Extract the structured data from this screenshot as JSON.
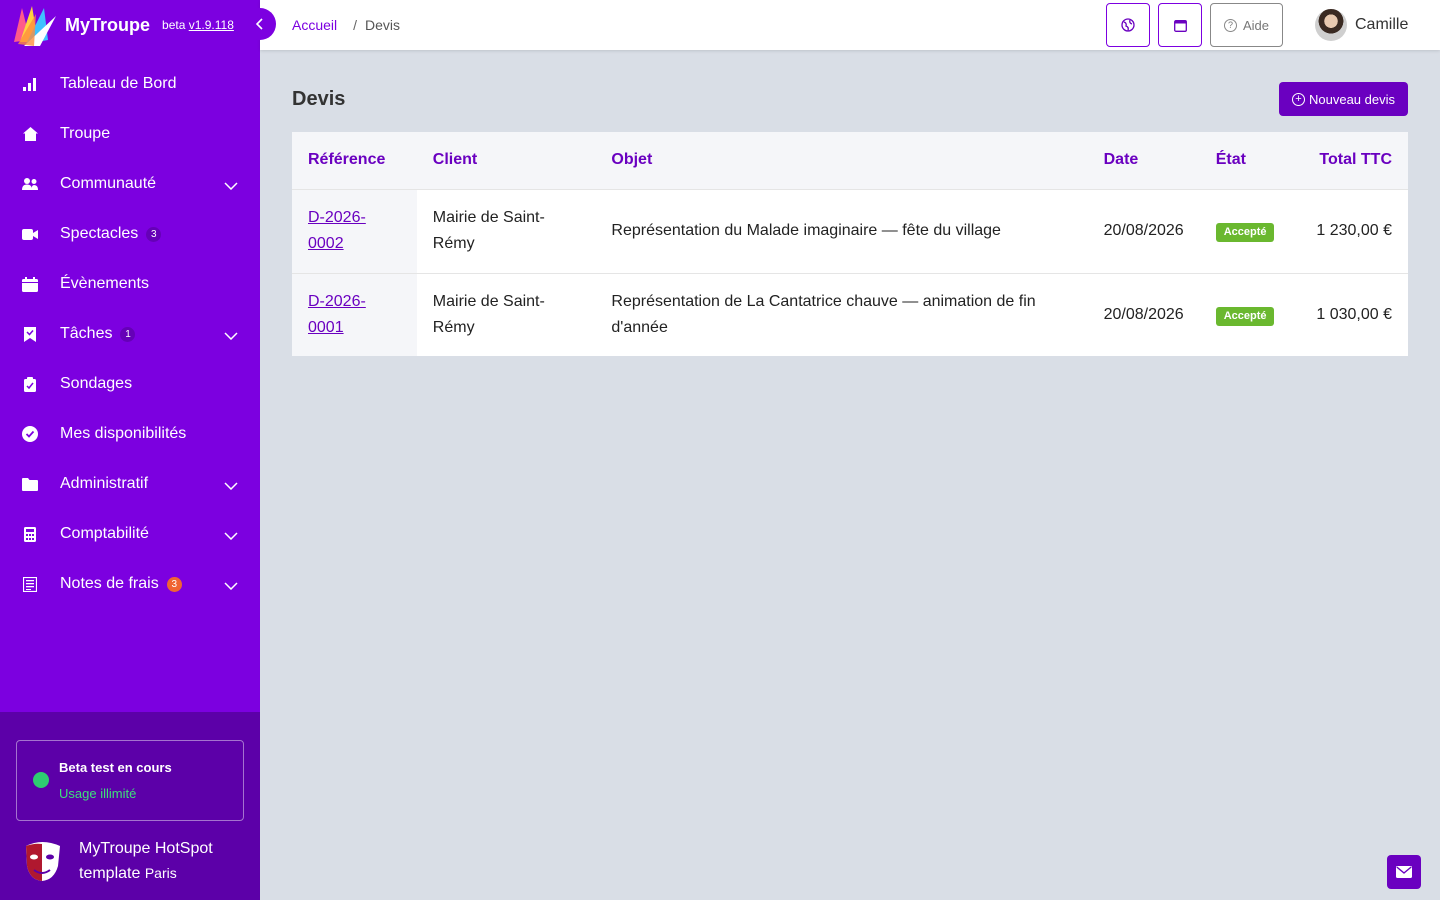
{
  "brand": {
    "app_name": "MyTroupe",
    "beta_label": "beta",
    "version": "v1.9.118"
  },
  "sidebar": {
    "items": [
      {
        "label": "Tableau de Bord",
        "icon": "bar-chart-icon"
      },
      {
        "label": "Troupe",
        "icon": "home-icon"
      },
      {
        "label": "Communauté",
        "icon": "users-icon",
        "expandable": true
      },
      {
        "label": "Spectacles",
        "icon": "video-camera-icon",
        "count": "3"
      },
      {
        "label": "Évènements",
        "icon": "calendar-icon"
      },
      {
        "label": "Tâches",
        "icon": "bookmark-icon",
        "count": "1",
        "expandable": true
      },
      {
        "label": "Sondages",
        "icon": "clipboard-icon"
      },
      {
        "label": "Mes disponibilités",
        "icon": "check-circle-icon"
      },
      {
        "label": "Administratif",
        "icon": "folder-icon",
        "expandable": true
      },
      {
        "label": "Comptabilité",
        "icon": "calculator-icon",
        "expandable": true
      },
      {
        "label": "Notes de frais",
        "icon": "receipt-icon",
        "count": "3",
        "expandable": true
      }
    ],
    "beta_box": {
      "title": "Beta test en cours",
      "usage": "Usage illimité"
    },
    "org": {
      "name_line1": "MyTroupe HotSpot",
      "name_line2": "template",
      "city": "Paris"
    }
  },
  "topbar": {
    "breadcrumb": {
      "home": "Accueil",
      "separator": "/",
      "current": "Devis"
    },
    "help_label": "Aide",
    "user_name": "Camille"
  },
  "main": {
    "title": "Devis",
    "new_button": "Nouveau devis",
    "columns": [
      "Référence",
      "Client",
      "Objet",
      "Date",
      "État",
      "Total TTC"
    ],
    "rows": [
      {
        "ref": "D-2026-0002",
        "client": "Mairie de Saint-Rémy",
        "object": "Représentation du Malade imaginaire — fête du village",
        "date": "20/08/2026",
        "state": "Accepté",
        "total": "1 230,00 €"
      },
      {
        "ref": "D-2026-0001",
        "client": "Mairie de Saint-Rémy",
        "object": "Représentation de La Cantatrice chauve — animation de fin d'année",
        "date": "20/08/2026",
        "state": "Accepté",
        "total": "1 030,00 €"
      }
    ]
  },
  "colors": {
    "primary": "#7c00e0",
    "primary_dark": "#6a00c0",
    "sidebar_bottom": "#5c00a8",
    "success": "#6ab82f",
    "online": "#2ecc71"
  }
}
